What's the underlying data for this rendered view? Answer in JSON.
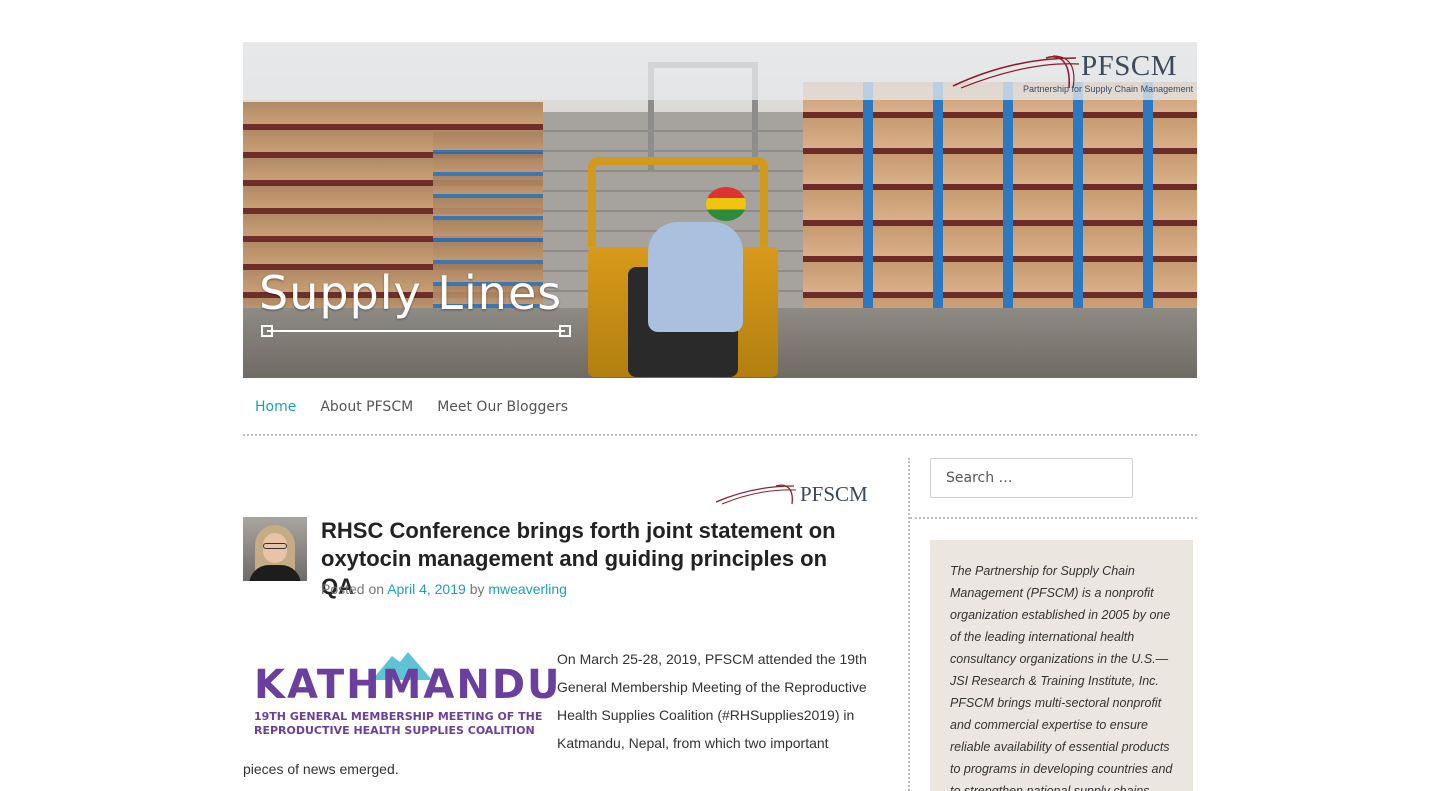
{
  "header": {
    "logo_text": "PFSCM",
    "logo_subtitle": "Partnership for Supply Chain Management",
    "banner_title": "Supply Lines"
  },
  "nav": {
    "items": [
      {
        "label": "Home",
        "active": true
      },
      {
        "label": "About PFSCM",
        "active": false
      },
      {
        "label": "Meet Our Bloggers",
        "active": false
      }
    ]
  },
  "post": {
    "logo_text": "PFSCM",
    "title": "RHSC Conference brings forth joint statement on oxytocin management and guiding principles on QA",
    "meta_prefix": "Posted on",
    "date": "April 4, 2019",
    "meta_by": "by",
    "author": "mweaverling",
    "image": {
      "word": "KATHMANDU",
      "subtitle_line1": "19TH GENERAL MEMBERSHIP MEETING OF THE",
      "subtitle_line2": "REPRODUCTIVE HEALTH SUPPLIES COALITION"
    },
    "body": "On March 25-28, 2019, PFSCM attended the 19th General Membership Meeting of the Reproductive Health Supplies Coalition (#RHSupplies2019) in Katmandu, Nepal, from which two important",
    "body_tail": "pieces of news emerged."
  },
  "sidebar": {
    "search_placeholder": "Search …",
    "about": "The Partnership for Supply Chain Management (PFSCM) is a nonprofit organization established in 2005 by one of the leading international health consultancy organizations in the U.S.—JSI Research & Training Institute, Inc. PFSCM brings multi-sectoral nonprofit and commercial expertise to ensure reliable availability of essential products to programs in developing countries and to strengthen national supply chains."
  },
  "colors": {
    "accent": "#1ba1b5",
    "logo_swoosh": "#8b1e2e",
    "kathmandu_purple": "#6b3f9e",
    "kathmandu_teal": "#5ec3d4",
    "sidebar_bg": "#ebe6df"
  }
}
